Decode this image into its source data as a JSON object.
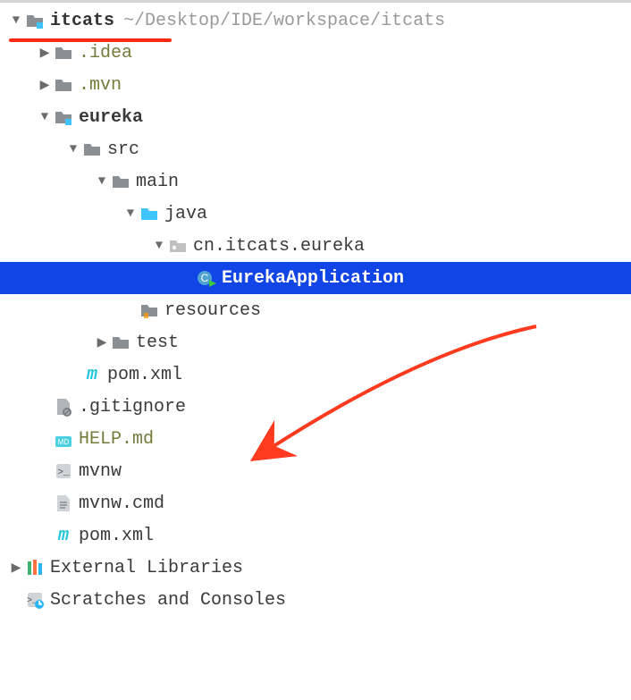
{
  "root": {
    "name": "itcats",
    "path": "~/Desktop/IDE/workspace/itcats"
  },
  "nodes": {
    "idea": ".idea",
    "mvn": ".mvn",
    "eureka": "eureka",
    "src": "src",
    "main": "main",
    "java": "java",
    "pkg": "cn.itcats.eureka",
    "app": "EurekaApplication",
    "resources": "resources",
    "test": "test",
    "pom1": "pom.xml",
    "gitignore": ".gitignore",
    "help": "HELP.md",
    "mvnw": "mvnw",
    "mvnwcmd": "mvnw.cmd",
    "pom2": "pom.xml",
    "extlib": "External Libraries",
    "scratches": "Scratches and Consoles"
  },
  "colors": {
    "selection": "#1245e6",
    "annotation": "#ff2a14"
  }
}
